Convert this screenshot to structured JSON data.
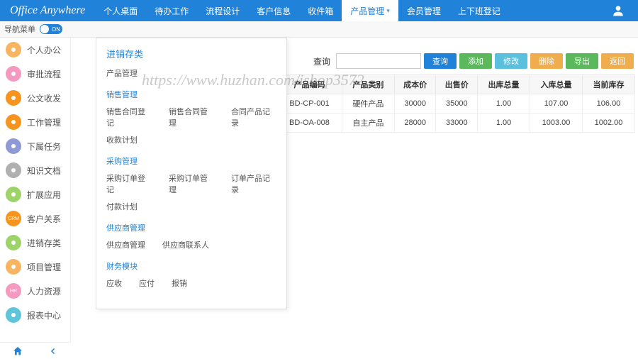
{
  "logo": "Office Anywhere",
  "topnav": [
    "个人桌面",
    "待办工作",
    "流程设计",
    "客户信息",
    "收件箱",
    "产品管理",
    "会员管理",
    "上下班登记"
  ],
  "topnav_active_index": 5,
  "nav_toggle_label": "导航菜单",
  "nav_toggle_state": "ON",
  "sidebar": [
    {
      "label": "个人办公",
      "color": "#f7b562",
      "icon": "user"
    },
    {
      "label": "审批流程",
      "color": "#f49ac1",
      "icon": "flow"
    },
    {
      "label": "公文收发",
      "color": "#f7941d",
      "icon": "mail"
    },
    {
      "label": "工作管理",
      "color": "#f7941d",
      "icon": "check"
    },
    {
      "label": "下属任务",
      "color": "#8e9ad6",
      "icon": "group"
    },
    {
      "label": "知识文档",
      "color": "#b0b0b0",
      "icon": "book"
    },
    {
      "label": "扩展应用",
      "color": "#9ed36a",
      "icon": "ext"
    },
    {
      "label": "客户关系",
      "color": "#f7941d",
      "icon": "CRM"
    },
    {
      "label": "进销存类",
      "color": "#9ed36a",
      "icon": "stock"
    },
    {
      "label": "项目管理",
      "color": "#f7b562",
      "icon": "proj"
    },
    {
      "label": "人力资源",
      "color": "#f49ac1",
      "icon": "HR"
    },
    {
      "label": "报表中心",
      "color": "#5ec6d8",
      "icon": "chart"
    }
  ],
  "dropdown": {
    "title": "进销存类",
    "basic": "产品管理",
    "sections": [
      {
        "header": "销售管理",
        "rows": [
          [
            "销售合同登记",
            "销售合同管理",
            "合同产品记录"
          ],
          [
            "收款计划"
          ]
        ]
      },
      {
        "header": "采购管理",
        "rows": [
          [
            "采购订单登记",
            "采购订单管理",
            "订单产品记录"
          ],
          [
            "付款计划"
          ]
        ]
      },
      {
        "header": "供应商管理",
        "rows": [
          [
            "供应商管理",
            "供应商联系人"
          ]
        ]
      },
      {
        "header": "财务模块",
        "rows": [
          [
            "应收",
            "应付",
            "报销"
          ]
        ]
      }
    ]
  },
  "toolbar": {
    "search_label": "查询",
    "search_placeholder": "",
    "buttons": [
      {
        "label": "查询",
        "color": "#2082d8"
      },
      {
        "label": "添加",
        "color": "#5cb85c"
      },
      {
        "label": "修改",
        "color": "#5bc0de"
      },
      {
        "label": "删除",
        "color": "#f0ad4e"
      },
      {
        "label": "导出",
        "color": "#5cb85c"
      },
      {
        "label": "返回",
        "color": "#f0ad4e"
      }
    ]
  },
  "table": {
    "headers": [
      "产品编码",
      "产品类别",
      "成本价",
      "出售价",
      "出库总量",
      "入库总量",
      "当前库存"
    ],
    "rows": [
      [
        "BD-CP-001",
        "硬件产品",
        "30000",
        "35000",
        "1.00",
        "107.00",
        "106.00"
      ],
      [
        "BD-OA-008",
        "自主产品",
        "28000",
        "33000",
        "1.00",
        "1003.00",
        "1002.00"
      ]
    ]
  },
  "watermark": "https://www.huzhan.com/ishop3572"
}
